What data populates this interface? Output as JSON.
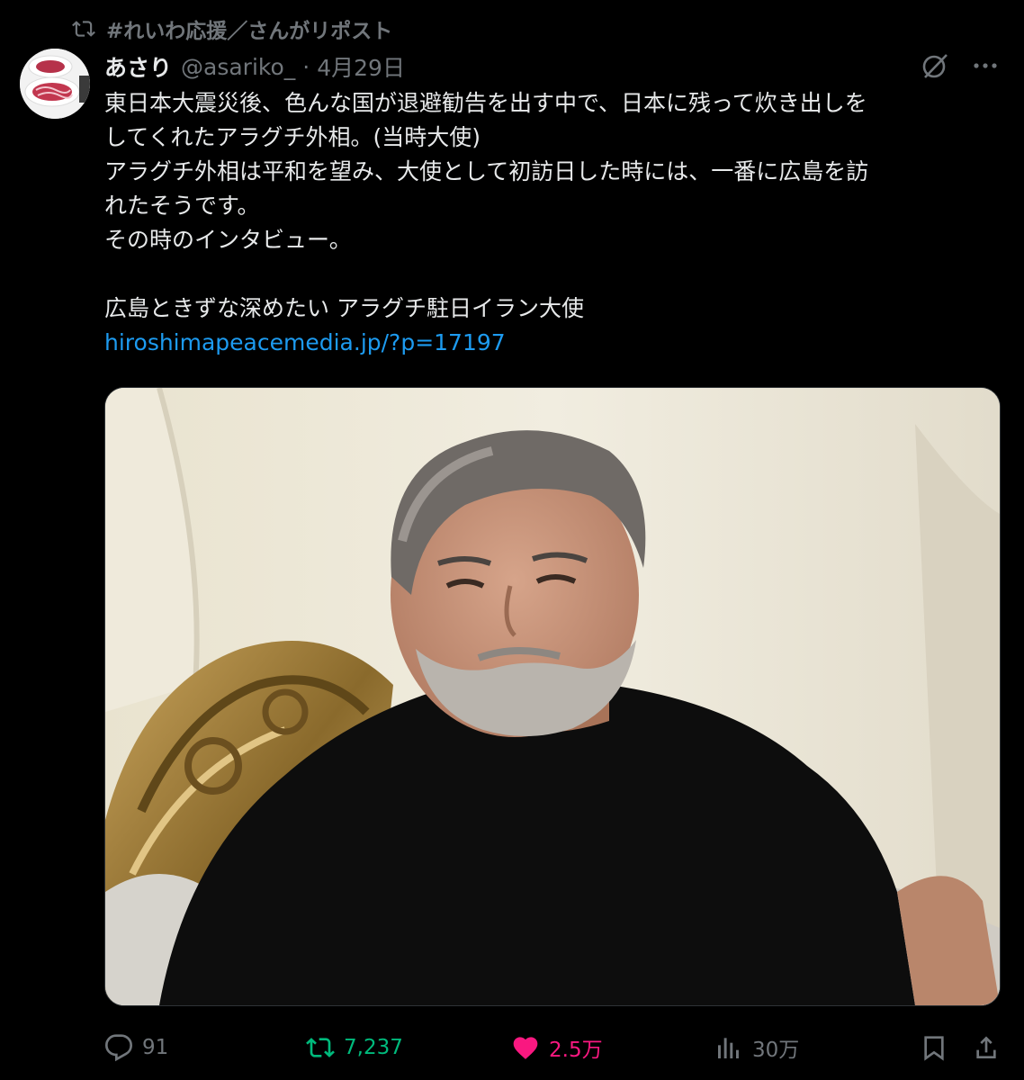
{
  "repost_banner": {
    "icon": "repost-icon",
    "text": "#れいわ応援／さんがリポスト"
  },
  "author": {
    "display_name": "あさり",
    "handle": "@asariko_",
    "separator": "·",
    "date": "4月29日"
  },
  "header_icons": [
    "grok-icon",
    "more-icon"
  ],
  "tweet": {
    "lines": [
      "東日本大震災後、色んな国が退避勧告を出す中で、日本に残って炊き出しを",
      "してくれたアラグチ外相。(当時大使)",
      "アラグチ外相は平和を望み、大使として初訪日した時には、一番に広島を訪",
      "れたそうです。",
      "その時のインタビュー。",
      "",
      "広島ときずな深めたい アラグチ駐日イラン大使"
    ],
    "link": "hiroshimapeacemedia.jp/?p=17197"
  },
  "media": {
    "description_icon": "photo-man-black-tshirt-golden-chair"
  },
  "actions": {
    "reply_count": "91",
    "repost_count": "7,237",
    "like_count": "2.5万",
    "view_count": "30万"
  },
  "colors": {
    "background": "#000000",
    "text": "#e7e9ea",
    "muted": "#71767b",
    "link": "#1d9bf0",
    "repost_active": "#00ba7c",
    "like_active": "#f91880"
  }
}
